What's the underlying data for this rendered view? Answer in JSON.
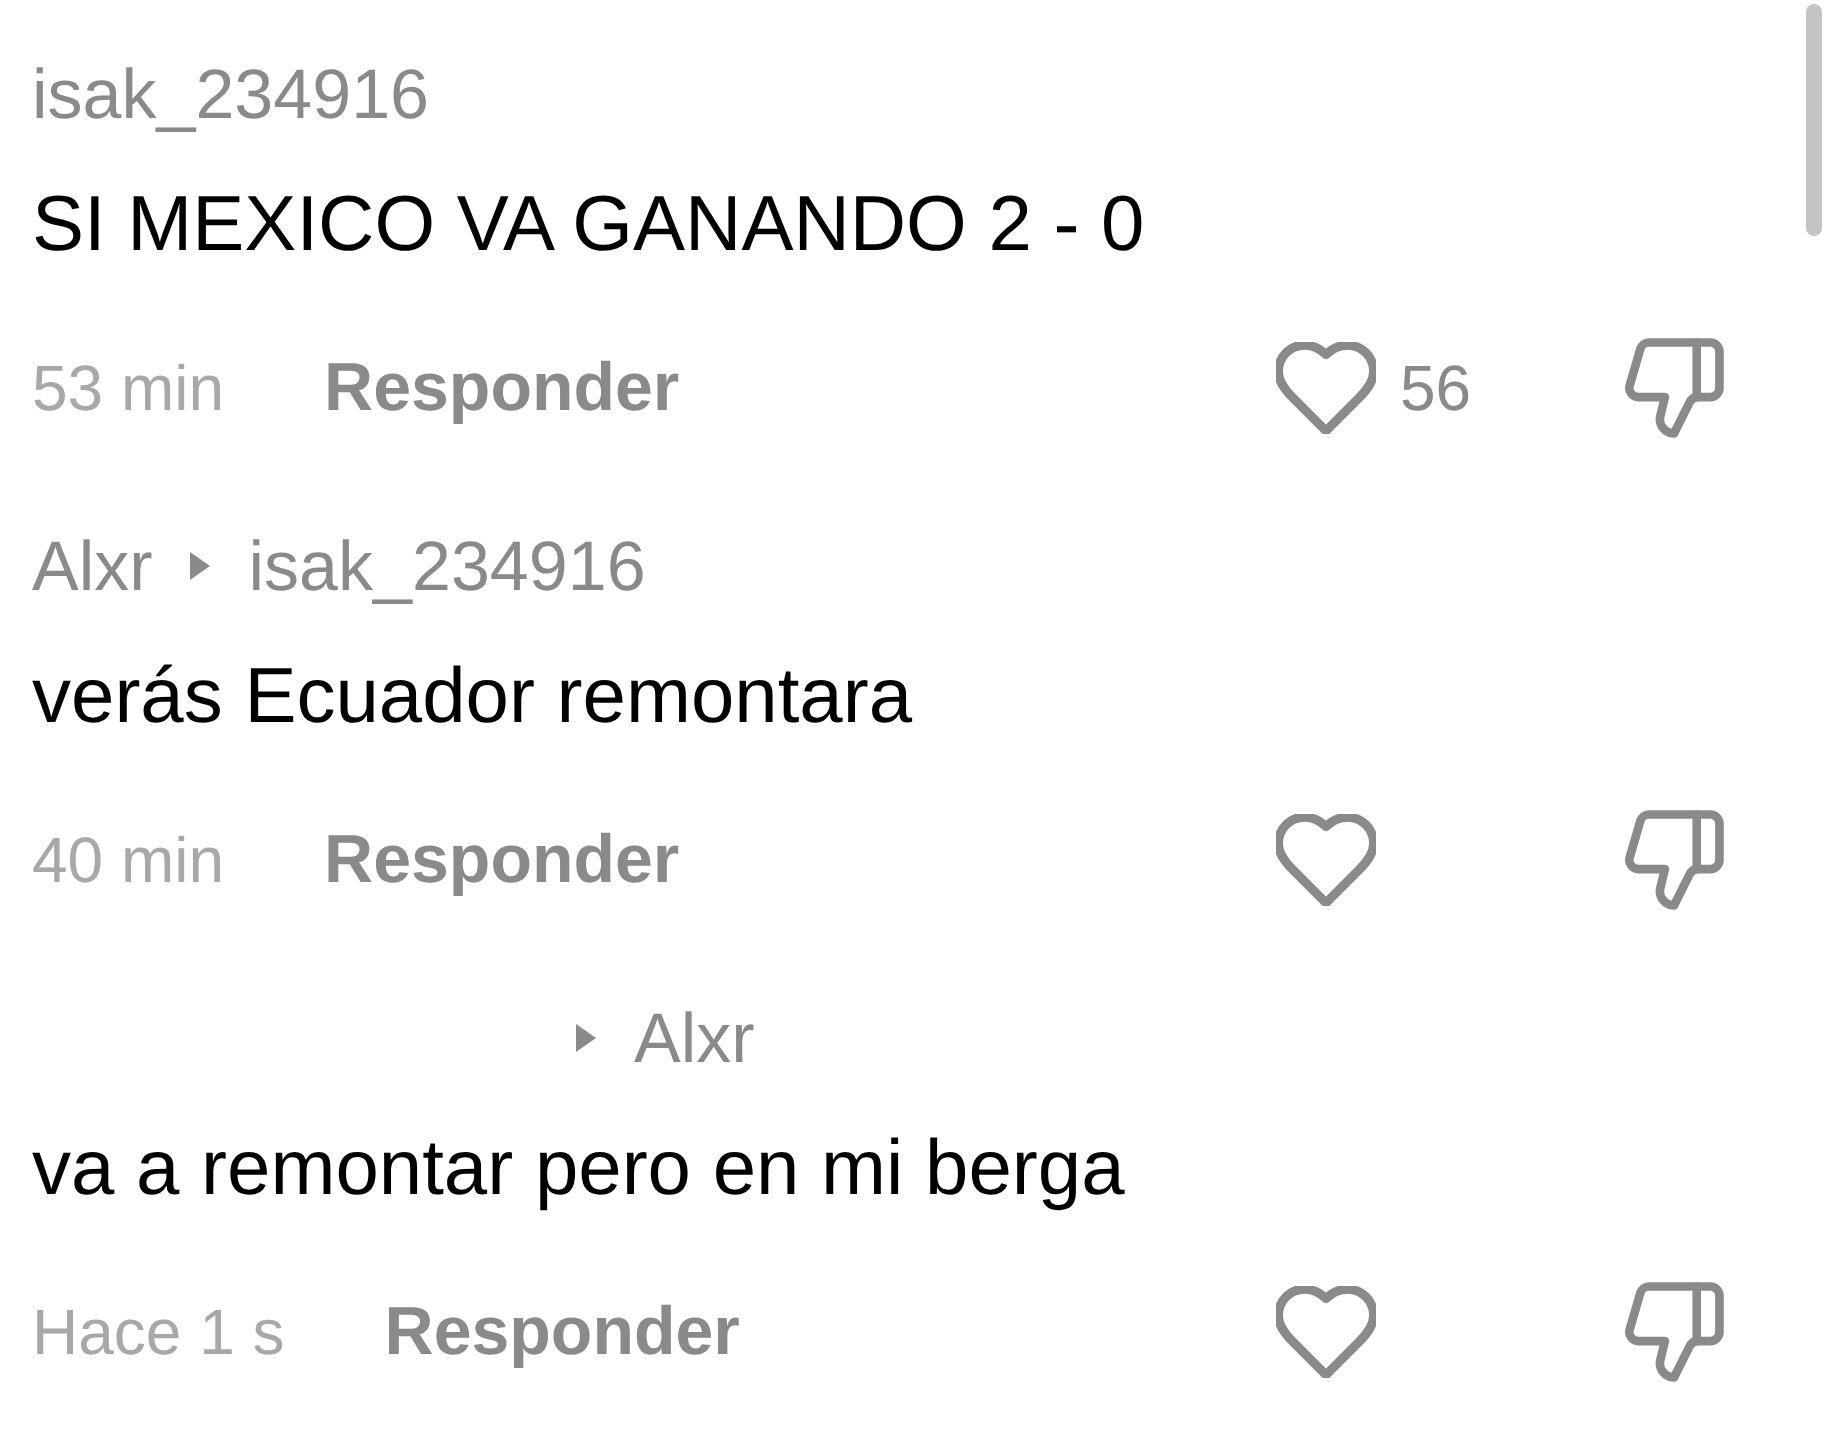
{
  "comments": [
    {
      "author": "isak_234916",
      "text": "SI MEXICO VA GANANDO 2 - 0",
      "time": "53 min",
      "reply_label": "Responder",
      "likes": "56",
      "liked": false,
      "disliked": false
    },
    {
      "author": "Alxr",
      "reply_to": "isak_234916",
      "text": "verás Ecuador remontara",
      "time": "40 min",
      "reply_label": "Responder",
      "liked": false,
      "disliked": false
    },
    {
      "reply_to": "Alxr",
      "text": "va a remontar pero en mi berga",
      "time": "Hace 1 s",
      "reply_label": "Responder",
      "liked": false,
      "disliked": false
    }
  ]
}
